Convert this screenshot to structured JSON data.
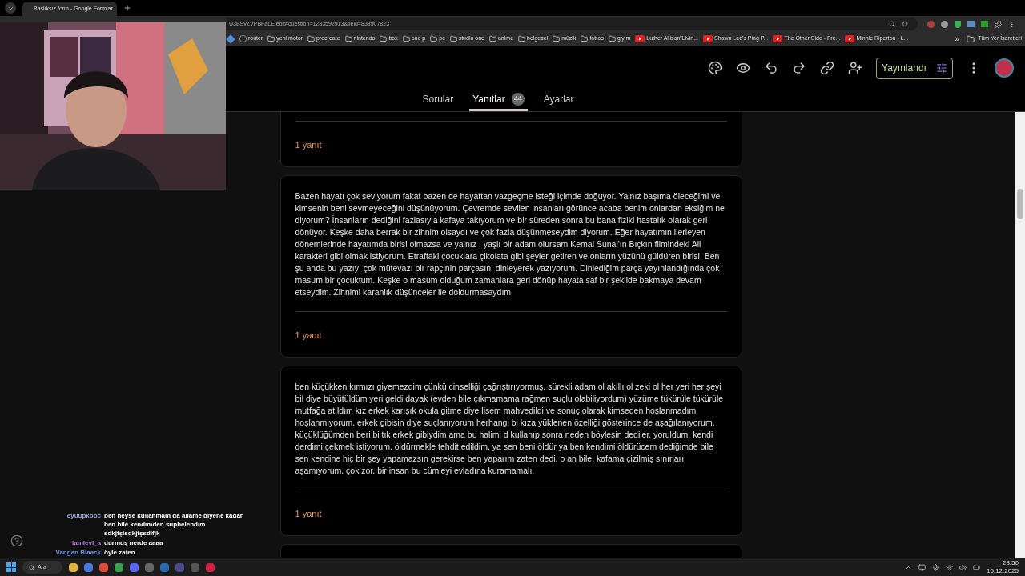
{
  "browser": {
    "tab": {
      "title": "Başlıksız form - Google Formlar",
      "selected": true
    },
    "url": "U3BSvZVPBFaLE/edit#question=1233592913&field=838907823",
    "bookmarks": [
      {
        "kind": "plain",
        "label": "router"
      },
      {
        "kind": "folder",
        "label": "yeni motor"
      },
      {
        "kind": "folder",
        "label": "procreate"
      },
      {
        "kind": "folder",
        "label": "nintendo"
      },
      {
        "kind": "folder",
        "label": "box"
      },
      {
        "kind": "folder",
        "label": "one p"
      },
      {
        "kind": "folder",
        "label": "pc"
      },
      {
        "kind": "folder",
        "label": "studio one"
      },
      {
        "kind": "folder",
        "label": "anime"
      },
      {
        "kind": "folder",
        "label": "belgesel"
      },
      {
        "kind": "folder",
        "label": "müzik"
      },
      {
        "kind": "folder",
        "label": "fottoo"
      },
      {
        "kind": "folder",
        "label": "giyim"
      },
      {
        "kind": "video",
        "label": "Luther Allison\"Livin..."
      },
      {
        "kind": "video",
        "label": "Shawn Lee's Ping P..."
      },
      {
        "kind": "video",
        "label": "The Other Side - Fre..."
      },
      {
        "kind": "video",
        "label": "Minnie Riperton - L..."
      }
    ],
    "more_bookmarks": "»",
    "all_bookmarks": "Tüm Yer İşaretleri"
  },
  "form_header": {
    "publish_button": "Yayınlandı",
    "tabs": [
      {
        "label": "Sorular",
        "selected": false
      },
      {
        "label": "Yanıtlar",
        "selected": true,
        "badge": "44"
      },
      {
        "label": "Ayarlar",
        "selected": false
      }
    ]
  },
  "responses": [
    {
      "footer": "1 yanıt"
    },
    {
      "text": "Bazen hayatı çok seviyorum fakat bazen de hayattan vazgeçme isteği içimde doğuyor. Yalnız başıma öleceğimi ve kimsenin beni sevmeyeceğini düşünüyorum. Çevremde sevilen insanları görünce acaba benim onlardan eksiğim ne diyorum? İnsanların dediğini fazlasıyla kafaya takıyorum ve bir süreden sonra bu bana fiziki hastalık olarak geri dönüyor. Keşke daha berrak bir zihnim olsaydı ve çok fazla düşünmeseydim diyorum. Eğer hayatımın ilerleyen dönemlerinde hayatımda birisi olmazsa ve yalnız , yaşlı bir adam olursam Kemal Sunal'ın Bıçkın filmindeki Ali karakteri gibi olmak istiyorum. Etraftaki çocuklara çikolata gibi şeyler getiren ve onların yüzünü güldüren birisi. Ben şu anda bu yazıyı çok mütevazı bir rapçinin parçasını dinleyerek yazıyorum. Dinlediğim parça yayınlandığında çok masum bir çocuktum. Keşke o masum olduğum zamanlara geri dönüp hayata saf bir şekilde bakmaya devam etseydim. Zihnimi karanlık düşünceler ile doldurmasaydım.",
      "footer": "1 yanıt"
    },
    {
      "text": "ben küçükken kırmızı giyemezdim çünkü cinselliği çağrıştırıyormuş. sürekli adam ol akıllı ol zeki ol her yeri her şeyi bil diye büyütüldüm yeri geldi dayak (evden bile çıkmamama rağmen suçlu olabiliyordum) yüzüme tükürüle tükürüle mutfağa atıldım kız erkek karışık okula gitme diye lisem mahvedildi ve sonuç olarak kimseden hoşlanmadım hoşlanmıyorum. erkek gibisin diye suçlanıyorum herhangi bi kıza yüklenen özelliği gösterince de aşağılanıyorum. küçüklüğümden beri bi tık erkek gibiydim ama bu halimi d kullanıp sonra neden böylesin dediler. yoruldum. kendi derdimi çekmek istiyorum. öldürmekle tehdit edildim. ya sen beni öldür ya ben kendimi öldürücem dediğimde bile sen kendine hiç bir şey yapamazsın gerekirse ben yaparım zaten dedi. o an bile. kafama çizilmiş sınırları aşamıyorum. çok zor. bir insan bu cümleyi evladına kuramamalı.",
      "footer": "1 yanıt"
    },
    {
      "kind": "partial"
    }
  ],
  "chat": [
    {
      "user": "eyuupkooc",
      "color": "#8fa3d6",
      "lines": [
        "ben neyse kullanmam da allame dıyene kadar",
        "ben bile kendımden suphelendım",
        "sdkjfşlsdkjfşsdlfjk"
      ]
    },
    {
      "user": "lamleyl_a",
      "color": "#b47ce0",
      "lines": [
        "durmuş nerde aaaa"
      ]
    },
    {
      "user": "Vangan Blaack",
      "color": "#6b8fe0",
      "lines": [
        "öyle zaten"
      ]
    }
  ],
  "taskbar": {
    "search": "Ara",
    "time": "23:50",
    "date": "16.12.2025"
  }
}
